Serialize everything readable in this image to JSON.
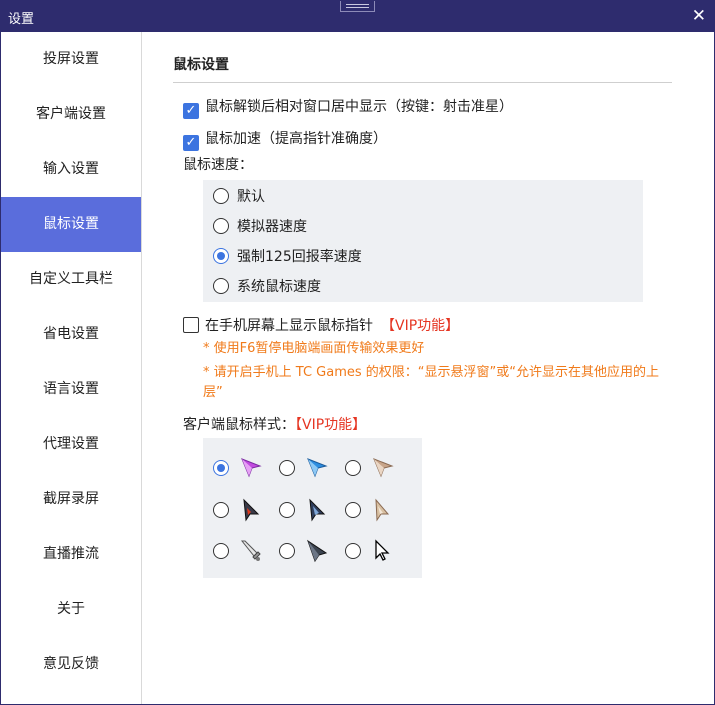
{
  "window": {
    "title": "设置",
    "close_glyph": "✕"
  },
  "sidebar": {
    "items": [
      {
        "label": "投屏设置",
        "active": false
      },
      {
        "label": "客户端设置",
        "active": false
      },
      {
        "label": "输入设置",
        "active": false
      },
      {
        "label": "鼠标设置",
        "active": true
      },
      {
        "label": "自定义工具栏",
        "active": false
      },
      {
        "label": "省电设置",
        "active": false
      },
      {
        "label": "语言设置",
        "active": false
      },
      {
        "label": "代理设置",
        "active": false
      },
      {
        "label": "截屏录屏",
        "active": false
      },
      {
        "label": "直播推流",
        "active": false
      },
      {
        "label": "关于",
        "active": false
      },
      {
        "label": "意见反馈",
        "active": false
      }
    ]
  },
  "mouse": {
    "section_title": "鼠标设置",
    "center_on_unlock": {
      "label": "鼠标解锁后相对窗口居中显示（按键：射击准星）",
      "checked": true
    },
    "acceleration": {
      "label": "鼠标加速（提高指针准确度）",
      "checked": true
    },
    "speed_label": "鼠标速度：",
    "speed_options": [
      {
        "label": "默认",
        "selected": false
      },
      {
        "label": "模拟器速度",
        "selected": false
      },
      {
        "label": "强制125回报率速度",
        "selected": true
      },
      {
        "label": "系统鼠标速度",
        "selected": false
      }
    ],
    "show_on_phone": {
      "label": "在手机屏幕上显示鼠标指针",
      "checked": false,
      "vip": "【VIP功能】"
    },
    "notes": [
      "* 使用F6暂停电脑端画面传输效果更好",
      "* 请开启手机上 TC Games 的权限：“显示悬浮窗”或“允许显示在其他应用的上层”"
    ],
    "cursor_style_label": "客户端鼠标样式：",
    "cursor_style_vip": "【VIP功能】",
    "cursor_styles": [
      {
        "icon": "purple-arrow-icon",
        "selected": true
      },
      {
        "icon": "blue-arrow-icon",
        "selected": false
      },
      {
        "icon": "beige-arrow-icon",
        "selected": false
      },
      {
        "icon": "dark-red-pointer-icon",
        "selected": false
      },
      {
        "icon": "dark-blue-pointer-icon",
        "selected": false
      },
      {
        "icon": "tan-pointer-icon",
        "selected": false
      },
      {
        "icon": "sword-icon",
        "selected": false
      },
      {
        "icon": "dark-blade-icon",
        "selected": false
      },
      {
        "icon": "standard-arrow-icon",
        "selected": false
      }
    ]
  },
  "colors": {
    "titlebar": "#2e2c6e",
    "active_nav": "#5a6ddc",
    "checkbox": "#3c74e0",
    "vip": "#e53522",
    "note": "#f07a1a",
    "panel": "#eef0f3"
  }
}
